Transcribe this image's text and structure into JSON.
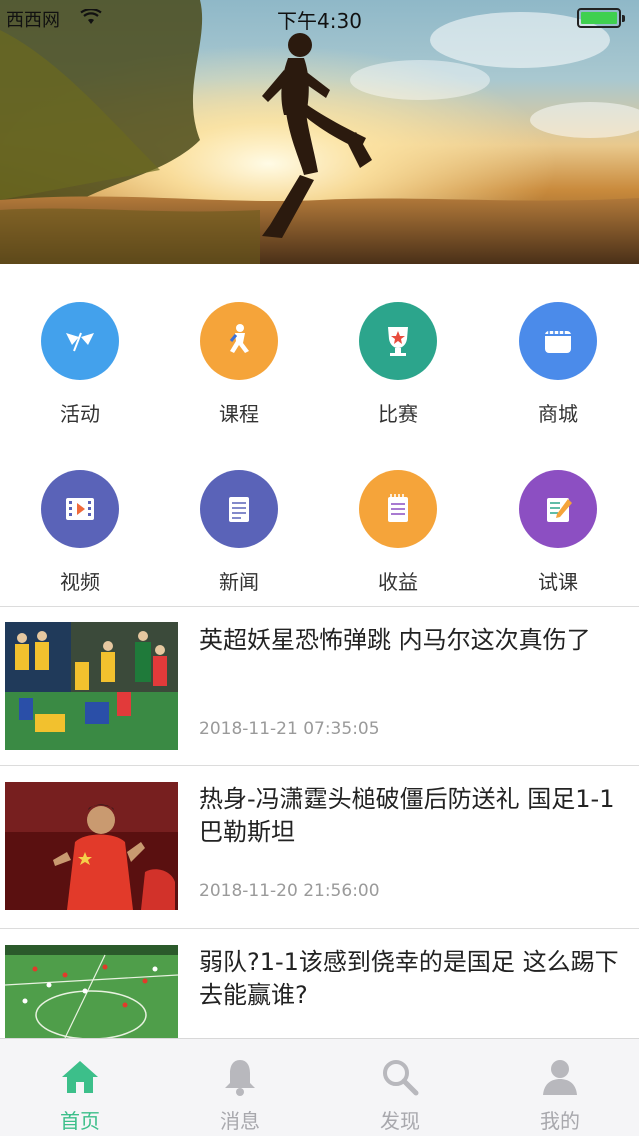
{
  "status_bar": {
    "carrier": "西西网",
    "time": "下午4:30",
    "battery_level": 1.0
  },
  "colors": {
    "accent": "#3cbf8a",
    "inactive": "#a8a8ad"
  },
  "features": [
    {
      "label": "活动",
      "icon": "flags-icon",
      "color": "#43a1ec"
    },
    {
      "label": "课程",
      "icon": "runner-icon",
      "color": "#f5a43a"
    },
    {
      "label": "比赛",
      "icon": "trophy-icon",
      "color": "#2ca58c"
    },
    {
      "label": "商城",
      "icon": "store-icon",
      "color": "#4b8bea"
    },
    {
      "label": "视频",
      "icon": "film-icon",
      "color": "#5a63b8"
    },
    {
      "label": "新闻",
      "icon": "notepad-icon",
      "color": "#5a63b8"
    },
    {
      "label": "收益",
      "icon": "clipboard-icon",
      "color": "#f5a43a"
    },
    {
      "label": "试课",
      "icon": "edit-icon",
      "color": "#8c4fc2"
    }
  ],
  "news": [
    {
      "title": "英超妖星恐怖弹跳 内马尔这次真伤了",
      "time": "2018-11-21 07:35:05"
    },
    {
      "title": "热身-冯潇霆头槌破僵后防送礼 国足1-1巴勒斯坦",
      "time": "2018-11-20 21:56:00"
    },
    {
      "title": "弱队?1-1该感到侥幸的是国足 这么踢下去能赢谁?",
      "time": ""
    }
  ],
  "tabs": [
    {
      "label": "首页",
      "icon": "home-icon",
      "active": true
    },
    {
      "label": "消息",
      "icon": "bell-icon",
      "active": false
    },
    {
      "label": "发现",
      "icon": "search-icon",
      "active": false
    },
    {
      "label": "我的",
      "icon": "person-icon",
      "active": false
    }
  ]
}
